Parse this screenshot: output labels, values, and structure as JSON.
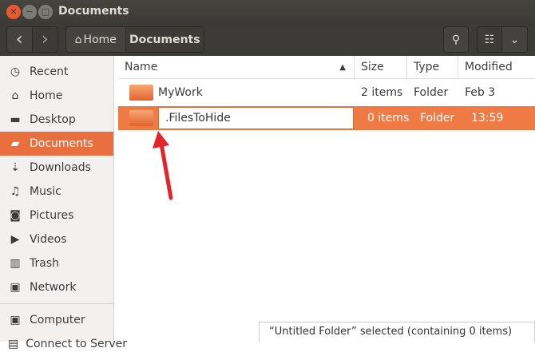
{
  "window": {
    "title": "Documents"
  },
  "toolbar": {
    "back": "‹",
    "forward": "›",
    "crumbs": [
      "Home",
      "Documents"
    ]
  },
  "sidebar": {
    "items": [
      {
        "label": "Recent",
        "icon": "clock-icon",
        "glyph": "◷"
      },
      {
        "label": "Home",
        "icon": "home-icon",
        "glyph": "⌂"
      },
      {
        "label": "Desktop",
        "icon": "desktop-icon",
        "glyph": "▬"
      },
      {
        "label": "Documents",
        "icon": "folder-icon",
        "glyph": "▰"
      },
      {
        "label": "Downloads",
        "icon": "download-icon",
        "glyph": "⇣"
      },
      {
        "label": "Music",
        "icon": "music-icon",
        "glyph": "♫"
      },
      {
        "label": "Pictures",
        "icon": "camera-icon",
        "glyph": "◙"
      },
      {
        "label": "Videos",
        "icon": "video-icon",
        "glyph": "▶"
      },
      {
        "label": "Trash",
        "icon": "trash-icon",
        "glyph": "▥"
      },
      {
        "label": "Network",
        "icon": "network-icon",
        "glyph": "▣"
      }
    ],
    "devices": [
      {
        "label": "Computer",
        "glyph": "▣"
      },
      {
        "label": "Connect to Server",
        "glyph": "▤"
      }
    ]
  },
  "columns": {
    "name": "Name",
    "size": "Size",
    "type": "Type",
    "modified": "Modified"
  },
  "rows": [
    {
      "name": "MyWork",
      "size": "2 items",
      "type": "Folder",
      "modified": "Feb 3"
    },
    {
      "name": ".FilesToHide",
      "size": "0 items",
      "type": "Folder",
      "modified": "13:59"
    }
  ],
  "status": "“Untitled Folder” selected  (containing 0 items)",
  "colors": {
    "accent": "#e9703e",
    "arrow": "#e3242b"
  }
}
